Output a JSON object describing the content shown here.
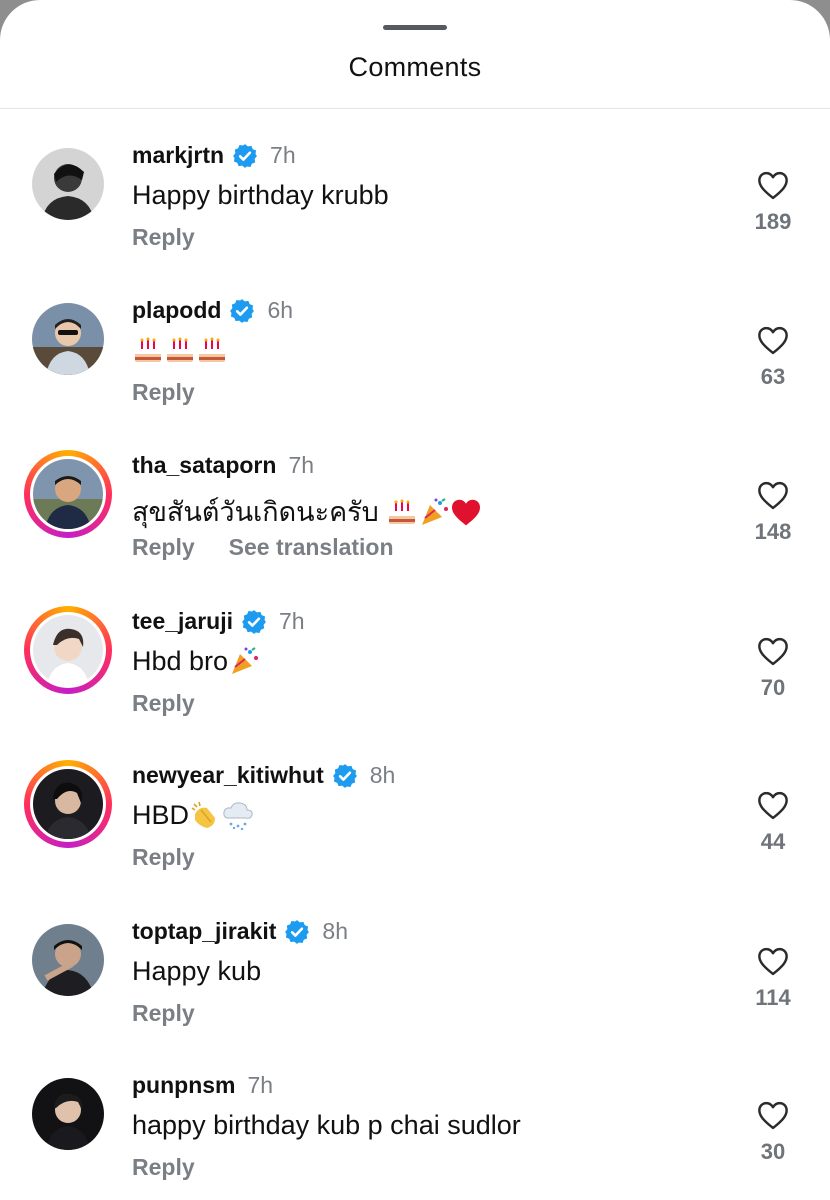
{
  "header": {
    "title": "Comments"
  },
  "comments": [
    {
      "username": "markjrtn",
      "verified": true,
      "time": "7h",
      "text": "Happy birthday krubb",
      "reply_label": "Reply",
      "likes": "189",
      "avatar_ring": false
    },
    {
      "username": "plapodd",
      "verified": true,
      "time": "6h",
      "text": "",
      "emoji": [
        "cake-emoji",
        "cake-emoji",
        "cake-emoji"
      ],
      "reply_label": "Reply",
      "likes": "63",
      "avatar_ring": false
    },
    {
      "username": "tha_sataporn",
      "verified": false,
      "time": "7h",
      "text": "สุขสันต์วันเกิดนะครับ ",
      "emoji": [
        "cake-emoji",
        "party-popper-emoji",
        "red-heart-emoji"
      ],
      "reply_label": "Reply",
      "translate_label": "See translation",
      "likes": "148",
      "avatar_ring": true
    },
    {
      "username": "tee_jaruji",
      "verified": true,
      "time": "7h",
      "text": "Hbd bro",
      "emoji": [
        "party-popper-emoji"
      ],
      "reply_label": "Reply",
      "likes": "70",
      "avatar_ring": true
    },
    {
      "username": "newyear_kitiwhut",
      "verified": true,
      "time": "8h",
      "text": "HBD",
      "emoji": [
        "clapping-hands-emoji",
        "snow-cloud-emoji"
      ],
      "reply_label": "Reply",
      "likes": "44",
      "avatar_ring": true
    },
    {
      "username": "toptap_jirakit",
      "verified": true,
      "time": "8h",
      "text": "Happy kub",
      "reply_label": "Reply",
      "likes": "114",
      "avatar_ring": false
    },
    {
      "username": "punpnsm",
      "verified": false,
      "time": "7h",
      "text": "happy birthday kub p chai sudlor",
      "reply_label": "Reply",
      "likes": "30",
      "avatar_ring": false
    }
  ],
  "colors": {
    "verified": "#1d9bf0",
    "ring_start": "#ffb000",
    "ring_mid": "#ff2f5b",
    "ring_end": "#c51ec6"
  }
}
